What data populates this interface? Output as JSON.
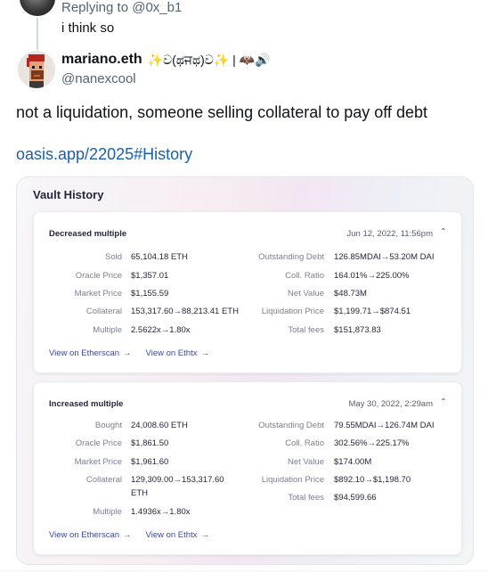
{
  "reply": {
    "replying_to": "Replying to @0x_b1",
    "text": "i think so"
  },
  "author": {
    "name": "mariano.eth",
    "decoration": "✨ව(ಥਜಥ)ව✨ | 🦇🔊",
    "handle": "@nanexcool"
  },
  "tweet": {
    "text": "not a liquidation, someone selling collateral to pay off debt",
    "link": "oasis.app/22025#History"
  },
  "vault_history": {
    "title": "Vault History",
    "cards": [
      {
        "title": "Decreased multiple",
        "date": "Jun 12, 2022, 11:56pm",
        "left": [
          {
            "label": "Sold",
            "value": "65,104.18 ETH"
          },
          {
            "label": "Oracle Price",
            "value": "$1,357.01"
          },
          {
            "label": "Market Price",
            "value": "$1,155.59"
          },
          {
            "label": "Collateral",
            "value": "153,317.60→88,213.41 ETH"
          },
          {
            "label": "Multiple",
            "value": "2.5622x→1.80x"
          }
        ],
        "right": [
          {
            "label": "Outstanding Debt",
            "value": "126.85MDAI→53.20M DAI"
          },
          {
            "label": "Coll. Ratio",
            "value": "164.01%→225.00%"
          },
          {
            "label": "Net Value",
            "value": "$48.73M"
          },
          {
            "label": "Liquidation Price",
            "value": "$1,199.71→$874.51"
          },
          {
            "label": "Total fees",
            "value": "$151,873.83"
          }
        ],
        "links": [
          "View on Etherscan",
          "View on Ethtx"
        ]
      },
      {
        "title": "Increased multiple",
        "date": "May 30, 2022, 2:29am",
        "left": [
          {
            "label": "Bought",
            "value": "24,008.60 ETH"
          },
          {
            "label": "Oracle Price",
            "value": "$1,861.50"
          },
          {
            "label": "Market Price",
            "value": "$1,961.60"
          },
          {
            "label": "Collateral",
            "value": "129,309.00→153,317.60",
            "value2": "ETH"
          },
          {
            "label": "Multiple",
            "value": "1.4936x→1.80x"
          }
        ],
        "right": [
          {
            "label": "Outstanding Debt",
            "value": "79.55MDAI→126.74M DAI"
          },
          {
            "label": "Coll. Ratio",
            "value": "302.56%→225.17%"
          },
          {
            "label": "Net Value",
            "value": "$174.00M"
          },
          {
            "label": "Liquidation Price",
            "value": "$892.10→$1,198.70"
          },
          {
            "label": "Total fees",
            "value": "$94,599.66"
          }
        ],
        "links": [
          "View on Etherscan",
          "View on Ethtx"
        ]
      }
    ]
  }
}
